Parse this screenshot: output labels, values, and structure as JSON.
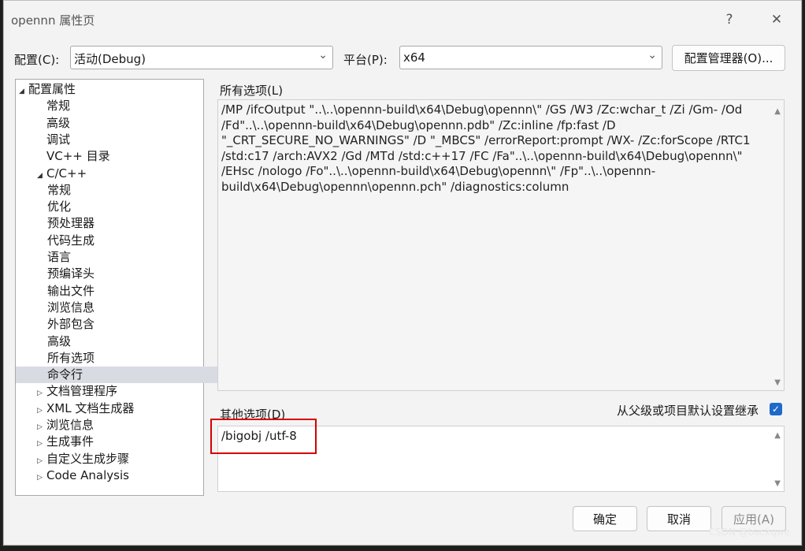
{
  "window": {
    "title": "opennn 属性页",
    "help_icon": "?",
    "close_icon": "✕"
  },
  "config_row": {
    "config_label": "配置(C):",
    "config_value": "活动(Debug)",
    "platform_label": "平台(P):",
    "platform_value": "x64",
    "manager_button": "配置管理器(O)..."
  },
  "tree": {
    "items": [
      {
        "label": "配置属性",
        "level": 0,
        "expander": "◢"
      },
      {
        "label": "常规",
        "level": 1
      },
      {
        "label": "高级",
        "level": 1
      },
      {
        "label": "调试",
        "level": 1
      },
      {
        "label": "VC++ 目录",
        "level": 1
      },
      {
        "label": "C/C++",
        "level": 1,
        "expander": "◢"
      },
      {
        "label": "常规",
        "level": 2
      },
      {
        "label": "优化",
        "level": 2
      },
      {
        "label": "预处理器",
        "level": 2
      },
      {
        "label": "代码生成",
        "level": 2
      },
      {
        "label": "语言",
        "level": 2
      },
      {
        "label": "预编译头",
        "level": 2
      },
      {
        "label": "输出文件",
        "level": 2
      },
      {
        "label": "浏览信息",
        "level": 2
      },
      {
        "label": "外部包含",
        "level": 2
      },
      {
        "label": "高级",
        "level": 2
      },
      {
        "label": "所有选项",
        "level": 2
      },
      {
        "label": "命令行",
        "level": 2,
        "selected": true
      },
      {
        "label": "文档管理程序",
        "level": 1,
        "expander": "▷"
      },
      {
        "label": "XML 文档生成器",
        "level": 1,
        "expander": "▷"
      },
      {
        "label": "浏览信息",
        "level": 1,
        "expander": "▷"
      },
      {
        "label": "生成事件",
        "level": 1,
        "expander": "▷"
      },
      {
        "label": "自定义生成步骤",
        "level": 1,
        "expander": "▷"
      },
      {
        "label": "Code Analysis",
        "level": 1,
        "expander": "▷"
      }
    ]
  },
  "all_options": {
    "label": "所有选项(L)",
    "text": "/MP /ifcOutput \"..\\..\\opennn-build\\x64\\Debug\\opennn\\\" /GS /W3 /Zc:wchar_t /Zi /Gm- /Od /Fd\"..\\..\\opennn-build\\x64\\Debug\\opennn.pdb\" /Zc:inline /fp:fast /D \"_CRT_SECURE_NO_WARNINGS\" /D \"_MBCS\" /errorReport:prompt /WX- /Zc:forScope /RTC1 /std:c17 /arch:AVX2 /Gd /MTd /std:c++17 /FC /Fa\"..\\..\\opennn-build\\x64\\Debug\\opennn\\\" /EHsc /nologo /Fo\"..\\..\\opennn-build\\x64\\Debug\\opennn\\\" /Fp\"..\\..\\opennn-build\\x64\\Debug\\opennn\\opennn.pch\" /diagnostics:column"
  },
  "other_options": {
    "label": "其他选项(D)",
    "value": "/bigobj /utf-8",
    "inherit_label": "从父级或项目默认设置继承",
    "inherit_checked": true
  },
  "buttons": {
    "ok": "确定",
    "cancel": "取消",
    "apply": "应用(A)"
  },
  "watermark": "CSDN @backqwe",
  "colors": {
    "accent": "#1f69c9",
    "highlight_box": "#d60000",
    "selection": "#d9dbe3"
  }
}
